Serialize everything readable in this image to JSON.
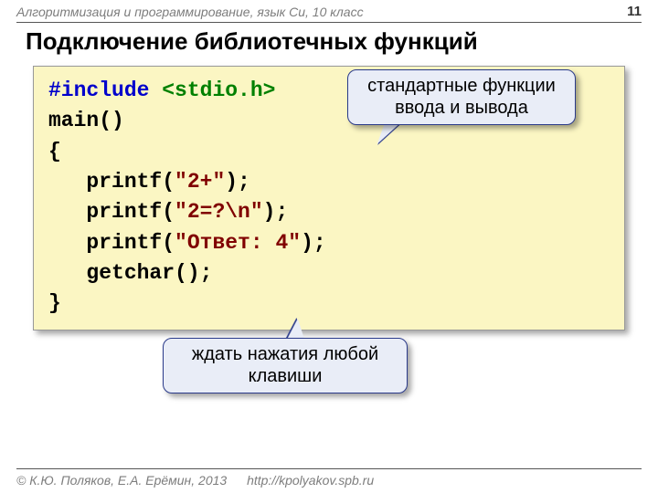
{
  "header": {
    "course": "Алгоритмизация и программирование, язык Си, 10 класс",
    "page": "11"
  },
  "title": "Подключение библиотечных функций",
  "code": {
    "include_kw": "#include ",
    "include_hdr": "<stdio.h>",
    "main_sig": "main()",
    "brace_open": "{",
    "line1_a": "   printf(",
    "line1_b": "\"2+\"",
    "line1_c": ");",
    "line2_a": "   printf(",
    "line2_b": "\"2=?\\n\"",
    "line2_c": ");",
    "line3_a": "   printf(",
    "line3_b": "\"Ответ: 4\"",
    "line3_c": ");",
    "line4": "   getchar();",
    "brace_close": "}"
  },
  "callouts": {
    "stdio": "стандартные функции\nввода и вывода",
    "getchar": "ждать нажатия любой\nклавиши"
  },
  "footer": {
    "copyright": "© К.Ю. Поляков, Е.А. Ерёмин, 2013",
    "url": "http://kpolyakov.spb.ru"
  }
}
